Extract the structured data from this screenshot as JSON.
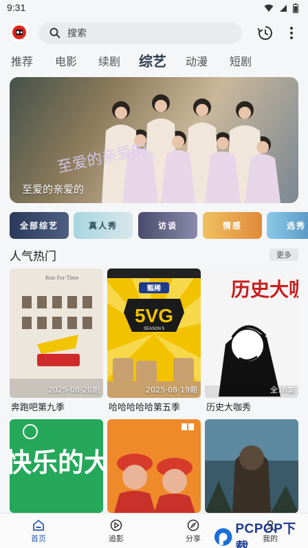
{
  "status_bar": {
    "time": "9:31"
  },
  "search": {
    "placeholder": "搜索"
  },
  "tabs": [
    {
      "label": "推荐"
    },
    {
      "label": "电影"
    },
    {
      "label": "续剧"
    },
    {
      "label": "综艺",
      "active": true
    },
    {
      "label": "动漫"
    },
    {
      "label": "短剧"
    }
  ],
  "banner": {
    "caption": "至爱的亲爱的",
    "title_art": "至爱的亲爱的"
  },
  "categories": [
    {
      "label": "全部综艺",
      "color": "#3a4a6a"
    },
    {
      "label": "真人秀",
      "color": "#9ec8d8"
    },
    {
      "label": "访谈",
      "color": "#6a6a8a"
    },
    {
      "label": "情感",
      "color": "#e0a040"
    },
    {
      "label": "选秀",
      "color": "#6aa0c8"
    }
  ],
  "section": {
    "title": "人气热门",
    "more": "更多"
  },
  "cards": [
    {
      "title": "奔跑吧第九季",
      "episode": "2025-08-20期"
    },
    {
      "title": "哈哈哈哈哈第五季",
      "episode": "2025-08-19期"
    },
    {
      "title": "历史大咖秀",
      "episode": "全16集"
    },
    {
      "title": "",
      "episode": ""
    },
    {
      "title": "",
      "episode": ""
    },
    {
      "title": "",
      "episode": ""
    }
  ],
  "poster_text": {
    "card1_top": "Run For Time",
    "card2_badge": "甄稀",
    "card2_logo": "5VG",
    "card2_sub": "SEASON 5",
    "card3_art": "历史大咖秀",
    "card4_art": "快乐的大"
  },
  "bottom_nav": [
    {
      "label": "首页",
      "active": true
    },
    {
      "label": "追影"
    },
    {
      "label": "分享"
    },
    {
      "label": "我的"
    }
  ],
  "watermark": {
    "text": "PCPOP下载"
  },
  "colors": {
    "accent": "#2a5db0",
    "active_tab": "#2c3e50"
  }
}
